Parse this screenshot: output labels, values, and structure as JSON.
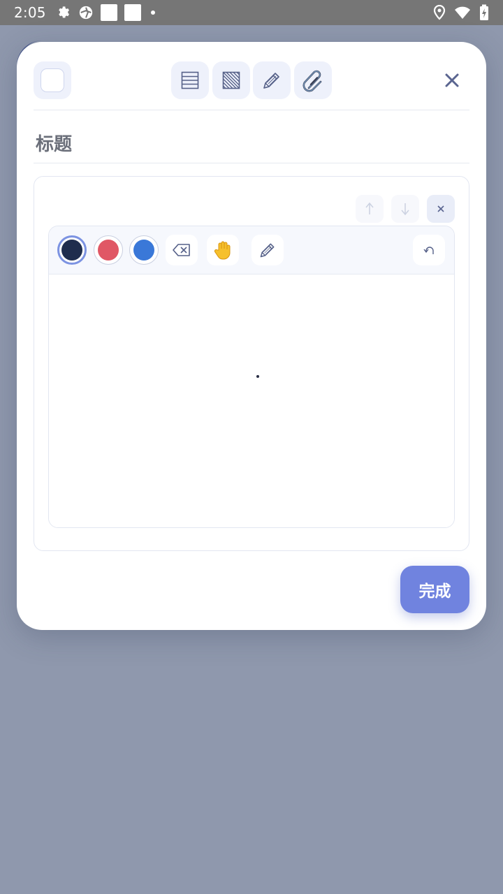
{
  "status_bar": {
    "time": "2:05",
    "left_icons": [
      "gear-icon",
      "aperture-icon",
      "square-icon",
      "square-icon",
      "dot-icon"
    ],
    "right_icons": [
      "location-icon",
      "wifi-icon",
      "battery-charging-icon"
    ]
  },
  "dialog": {
    "toolbar": {
      "items": [
        "color-swatch",
        "lines-icon",
        "hatch-icon",
        "pencil-icon",
        "paperclip-icon"
      ],
      "close_icon": "close-icon"
    },
    "title_placeholder": "标题",
    "block": {
      "controls": [
        "up-arrow-icon",
        "down-arrow-icon",
        "close-icon"
      ],
      "pen_colors": [
        "#1f2d4d",
        "#e05765",
        "#3a78d8"
      ],
      "selected_pen_color": "#1f2d4d",
      "tools": [
        "eraser-icon",
        "hand-icon",
        "pen-icon",
        "undo-icon"
      ]
    },
    "done_label": "完成"
  }
}
